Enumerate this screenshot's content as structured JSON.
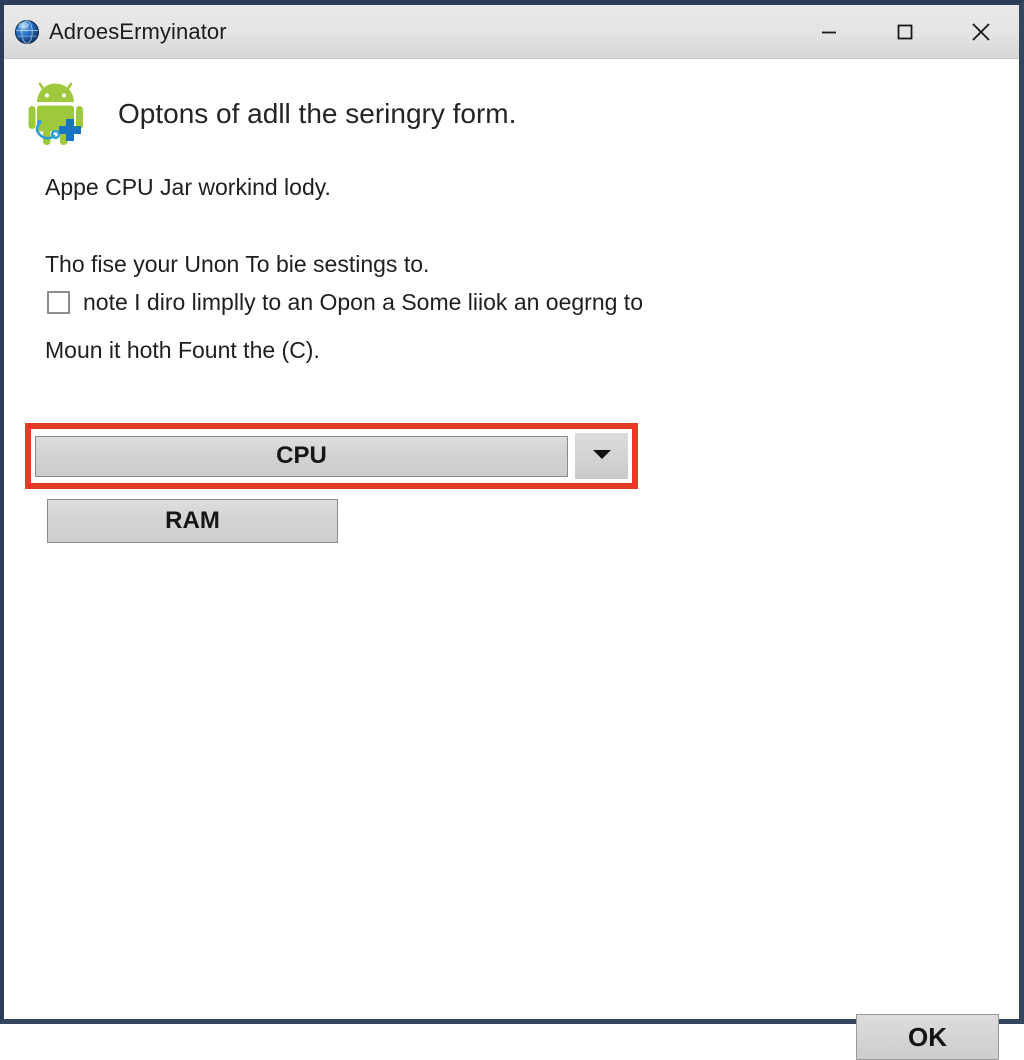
{
  "window": {
    "title": "AdroesErmyinator",
    "app_icon": "globe-icon",
    "border_color": "#2b3d58",
    "titlebar_bg": "#e4e4e4",
    "controls": [
      {
        "name": "minimize",
        "glyph": "minimize-icon"
      },
      {
        "name": "maximize",
        "glyph": "maximize-icon"
      },
      {
        "name": "close",
        "glyph": "close-icon"
      }
    ]
  },
  "content": {
    "icon": "android-doctor-icon",
    "heading": "Optons of adll the seringry form.",
    "status_line": "Appe CPU Jar workind lody.",
    "intro_line": "Tho fise your Unon To bie sestings to.",
    "checkbox": {
      "label": "note I diro limplly to an Opon a Some liiok an oegrng to",
      "checked": false
    },
    "after_line": "Moun it hoth Fount the (C).",
    "cpu_dropdown": {
      "value": "CPU",
      "arrow_icon": "chevron-down-icon",
      "highlight_color": "#e03c28"
    },
    "ram_button": {
      "label": "RAM"
    }
  },
  "footer": {
    "ok_label": "OK"
  }
}
